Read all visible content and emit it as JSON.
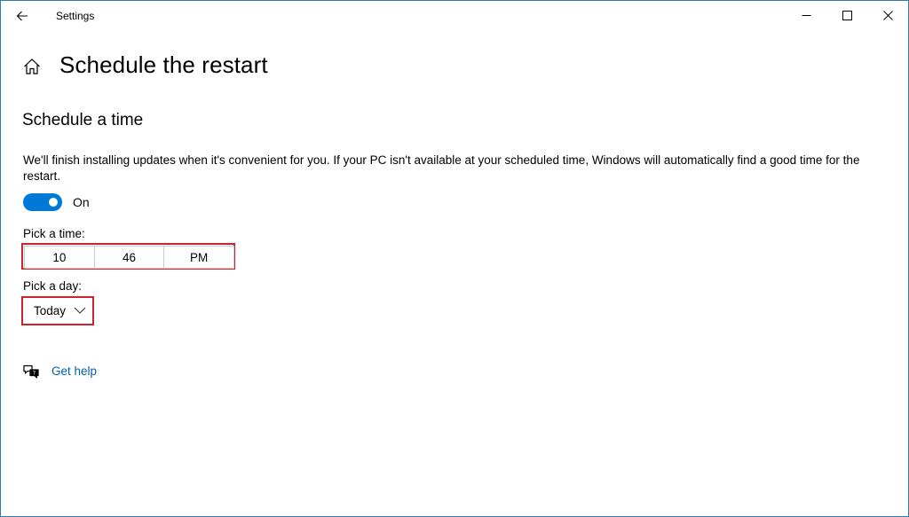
{
  "titlebar": {
    "app_title": "Settings"
  },
  "header": {
    "page_title": "Schedule the restart"
  },
  "section": {
    "title": "Schedule a time",
    "description": "We'll finish installing updates when it's convenient for you. If your PC isn't available at your scheduled time, Windows will automatically find a good time for the restart."
  },
  "toggle": {
    "state_label": "On",
    "is_on": true
  },
  "time_picker": {
    "label": "Pick a time:",
    "hour": "10",
    "minute": "46",
    "period": "PM"
  },
  "day_picker": {
    "label": "Pick a day:",
    "selected": "Today"
  },
  "help": {
    "link_text": "Get help"
  },
  "colors": {
    "accent": "#0078d7",
    "link": "#0063b1",
    "highlight_box": "#d0212f",
    "window_border": "#2b7bb9"
  },
  "icons": {
    "back": "back-arrow-icon",
    "minimize": "minimize-icon",
    "maximize": "maximize-icon",
    "close": "close-icon",
    "home": "home-icon",
    "dropdown": "chevron-down-icon",
    "help": "help-chat-icon"
  }
}
